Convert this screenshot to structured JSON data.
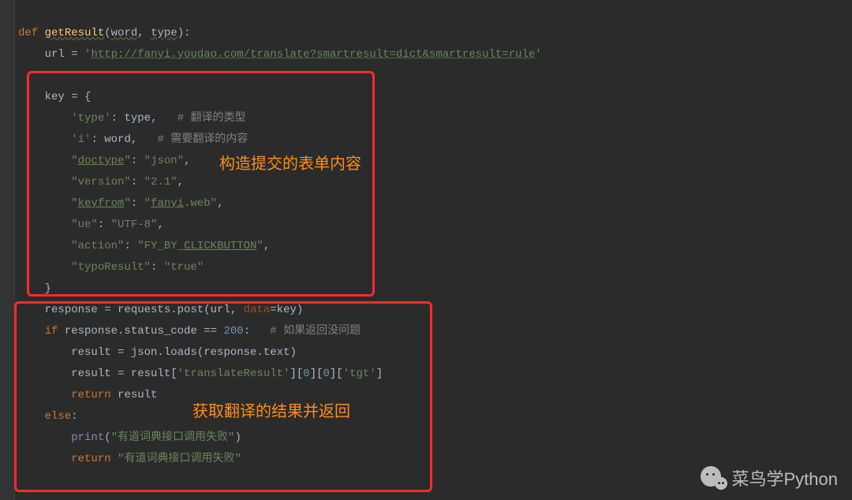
{
  "code": {
    "l1_def": "def",
    "l1_fn": "getResult",
    "l1_p1": "word",
    "l1_p2": "type",
    "l2_var": "url",
    "l2_eq": " = ",
    "l2_q": "'",
    "l2_url": "http://fanyi.youdao.com/translate?smartresult=dict&smartresult=rule",
    "l4": "key = {",
    "l5_k": "'type'",
    "l5_c": ": ",
    "l5_v": "type",
    "l5_end": ",   ",
    "l5_com": "# 翻译的类型",
    "l6_k": "'i'",
    "l6_c": ": ",
    "l6_v": "word",
    "l6_end": ",   ",
    "l6_com": "# 需要翻译的内容",
    "l7_k1": "\"",
    "l7_ku": "doctype",
    "l7_k2": "\"",
    "l7_c": ": ",
    "l7_v": "\"json\"",
    "l7_end": ",",
    "l8_k": "\"version\"",
    "l8_c": ": ",
    "l8_v": "\"2.1\"",
    "l8_end": ",",
    "l9_k1": "\"",
    "l9_ku": "keyfrom",
    "l9_k2": "\"",
    "l9_c": ": ",
    "l9_v1": "\"",
    "l9_vu": "fanyi",
    "l9_v2": ".web\"",
    "l9_end": ",",
    "l10_k": "\"ue\"",
    "l10_c": ": ",
    "l10_v": "\"UTF-8\"",
    "l10_end": ",",
    "l11_k": "\"action\"",
    "l11_c": ": ",
    "l11_v1": "\"FY_BY_",
    "l11_vu": "CLICKBUTTON",
    "l11_v2": "\"",
    "l11_end": ",",
    "l12_k": "\"typoResult\"",
    "l12_c": ": ",
    "l12_v": "\"true\"",
    "l13": "}",
    "l14_a": "response = requests.post(url, ",
    "l14_p": "data",
    "l14_b": "=key)",
    "l15_if": "if",
    "l15_a": " response.status_code == ",
    "l15_n": "200",
    "l15_b": ":   ",
    "l15_com": "# 如果返回没问题",
    "l16": "result = json.loads(response.text)",
    "l17_a": "result = result[",
    "l17_s1": "'translateResult'",
    "l17_b": "][",
    "l17_n0": "0",
    "l17_c": "][",
    "l17_n1": "0",
    "l17_d": "][",
    "l17_s2": "'tgt'",
    "l17_e": "]",
    "l18_ret": "return",
    "l18_v": " result",
    "l19_else": "else",
    "l19_c": ":",
    "l20_print": "print",
    "l20_o": "(",
    "l20_s": "\"有道词典接口调用失败\"",
    "l20_cl": ")",
    "l21_ret": "return",
    "l21_sp": " ",
    "l21_s": "\"有道词典接口调用失败\""
  },
  "anno": {
    "label1": "构造提交的表单内容",
    "label2": "获取翻译的结果并返回"
  },
  "watermark": "菜鸟学Python"
}
